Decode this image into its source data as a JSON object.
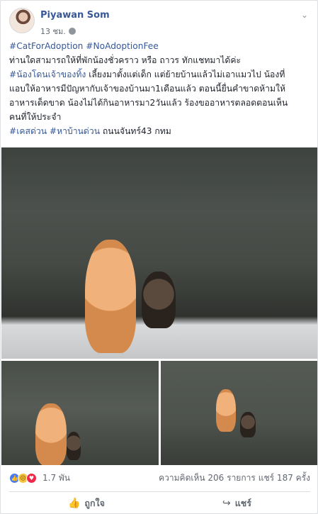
{
  "post": {
    "author": "Piyawan Som",
    "time": "13 ชม.",
    "lines": [
      {
        "text": "#CatForAdoption #NoAdoptionFee",
        "tag": true
      },
      {
        "text": "ท่านใดสามารถให้ที่พักน้องชั่วคราว หรือ ถาวร ทักแชทมาได้ค่ะ",
        "tag": false
      },
      {
        "tag_text": "#น้องโดนเจ้าของทิ้ง",
        "text": " เลี้ยงมาตั้งแต่เด็ก แต่ย้ายบ้านแล้วไม่เอาแมวไป น้องที่"
      },
      {
        "text": "แอบให้อาหารมีปัญหากับเจ้าของบ้านมา1เดือนแล้ว ตอนนี้ยื่นคำขาดห้ามให้",
        "tag": false
      },
      {
        "text": "อาหารเด็ดขาด น้องไม่ได้กินอาหารมา2วันแล้ว ร้องขออาหารตลอดตอนเห็น",
        "tag": false
      },
      {
        "text": "คนที่ให้ประจำ",
        "tag": false
      },
      {
        "tag_text": "#เคสด่วน #หาบ้านด่วน",
        "text": " ถนนจันทร์43 กทม"
      }
    ]
  },
  "reactions": {
    "count": "1.7 พัน",
    "comments": "ความคิดเห็น 206 รายการ",
    "shares": "แชร์ 187 ครั้ง",
    "icons": [
      "like-react",
      "sad-react",
      "love-react"
    ]
  },
  "actions": {
    "like": "ถูกใจ",
    "share": "แชร์"
  },
  "colors": {
    "link": "#385898",
    "hashtag": "#365899",
    "muted": "#616770"
  }
}
